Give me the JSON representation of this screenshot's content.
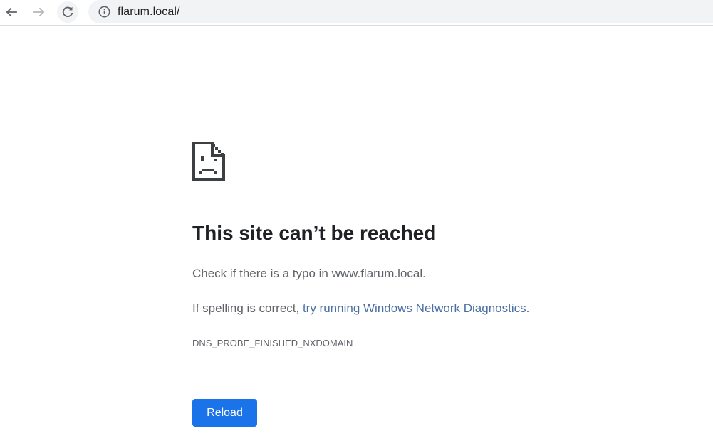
{
  "toolbar": {
    "url": "flarum.local/",
    "icons": {
      "back": "arrow-left-icon",
      "forward": "arrow-right-icon",
      "reload": "reload-icon",
      "info": "info-circle-icon"
    }
  },
  "error": {
    "icon": "sad-document-icon",
    "title": "This site can’t be reached",
    "check_text": "Check if there is a typo in www.flarum.local.",
    "spelling_prefix": "If spelling is correct, ",
    "spelling_link": "try running Windows Network Diagnostics",
    "spelling_suffix": ".",
    "code": "DNS_PROBE_FINISHED_NXDOMAIN",
    "reload_label": "Reload"
  },
  "colors": {
    "accent": "#1a73e8",
    "link": "#4a6fa5",
    "title": "#202124",
    "body_text": "#5f6368",
    "omnibox_bg": "#f1f3f4"
  }
}
